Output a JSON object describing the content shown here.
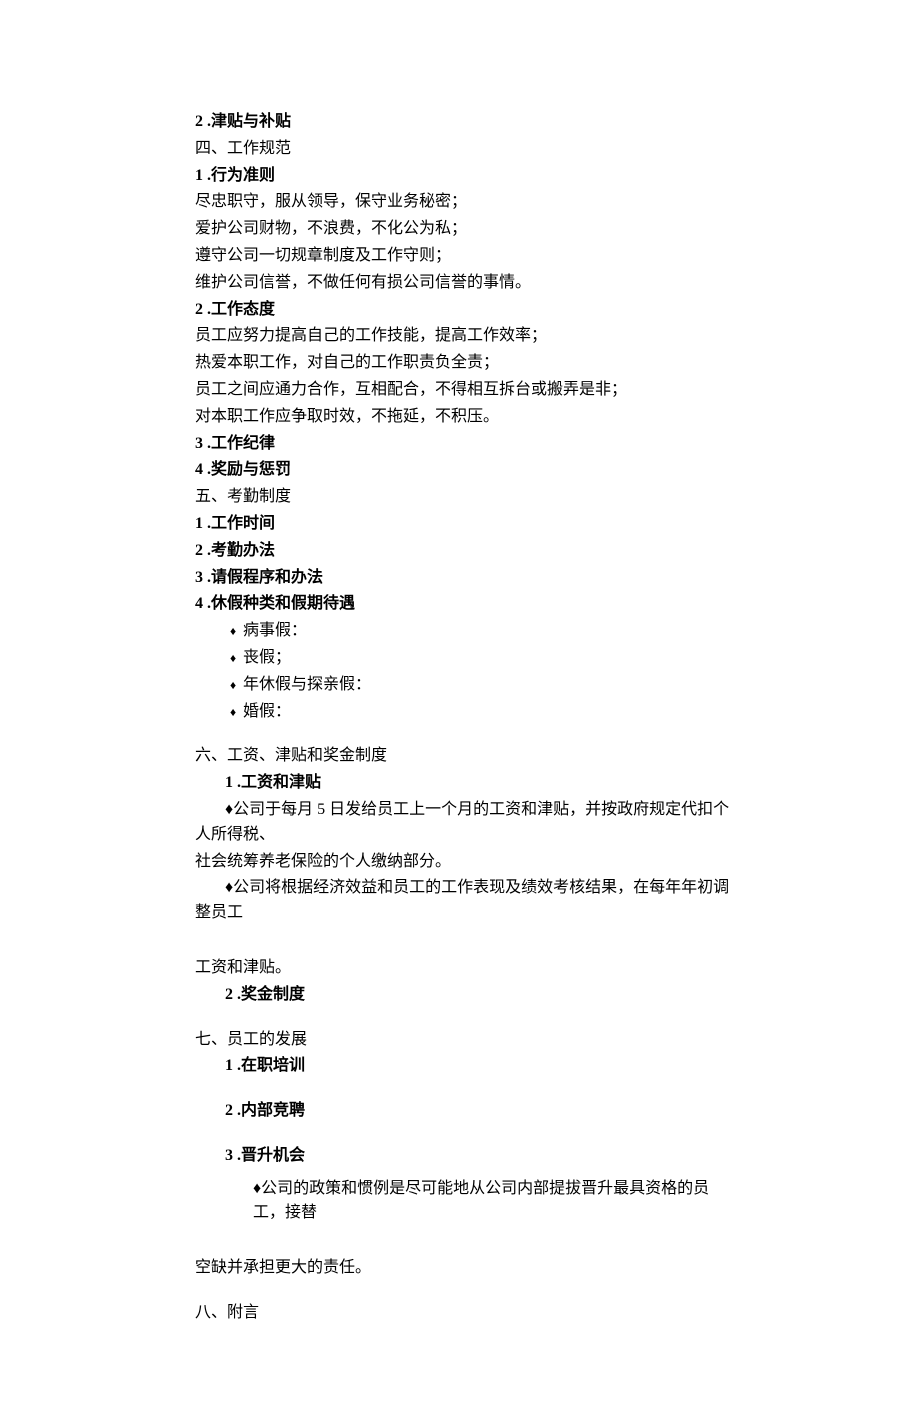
{
  "s1": {
    "n": "2",
    "t": ".津贴与补贴"
  },
  "s2": "四、工作规范",
  "s3": {
    "n": "1",
    "t": ".行为准则"
  },
  "body1": [
    "尽忠职守，服从领导，保守业务秘密；",
    "爱护公司财物，不浪费，不化公为私；",
    "遵守公司一切规章制度及工作守则；",
    "维护公司信誉，不做任何有损公司信誉的事情。"
  ],
  "s4": {
    "n": "2",
    "t": ".工作态度"
  },
  "body2": [
    "员工应努力提高自己的工作技能，提高工作效率；",
    "热爱本职工作，对自己的工作职责负全责；",
    "员工之间应通力合作，互相配合，不得相互拆台或搬弄是非；",
    "对本职工作应争取时效，不拖延，不积压。"
  ],
  "s5": {
    "n": "3",
    "t": ".工作纪律"
  },
  "s6": {
    "n": "4",
    "t": ".奖励与惩罚"
  },
  "s7": "五、考勤制度",
  "s8": {
    "n": "1",
    "t": ".工作时间"
  },
  "s9": {
    "n": "2",
    "t": ".考勤办法"
  },
  "s10": {
    "n": "3",
    "t": ".请假程序和办法"
  },
  "s11": {
    "n": "4",
    "t": ".休假种类和假期待遇"
  },
  "bullets": [
    "病事假：",
    "丧假；",
    "年休假与探亲假：",
    "婚假："
  ],
  "s12": "六、工资、津贴和奖金制度",
  "s13": {
    "n": "1",
    "t": ".工资和津贴"
  },
  "p1a": "♦公司于每月 5 日发给员工上一个月的工资和津贴，并按政府规定代扣个人所得税、",
  "p1b": "社会统筹养老保险的个人缴纳部分。",
  "p2a": "♦公司将根据经济效益和员工的工作表现及绩效考核结果，在每年年初调整员工",
  "p2b": "工资和津贴。",
  "s14": {
    "n": "2",
    "t": ".奖金制度"
  },
  "s15": "七、员工的发展",
  "s16": {
    "n": "1",
    "t": ".在职培训"
  },
  "s17": {
    "n": "2",
    "t": ".内部竞聘"
  },
  "s18": {
    "n": "3",
    "t": ".晋升机会"
  },
  "p3a": "♦公司的政策和惯例是尽可能地从公司内部提拔晋升最具资格的员工，接替",
  "p3b": "空缺并承担更大的责任。",
  "s19": "八、附言"
}
